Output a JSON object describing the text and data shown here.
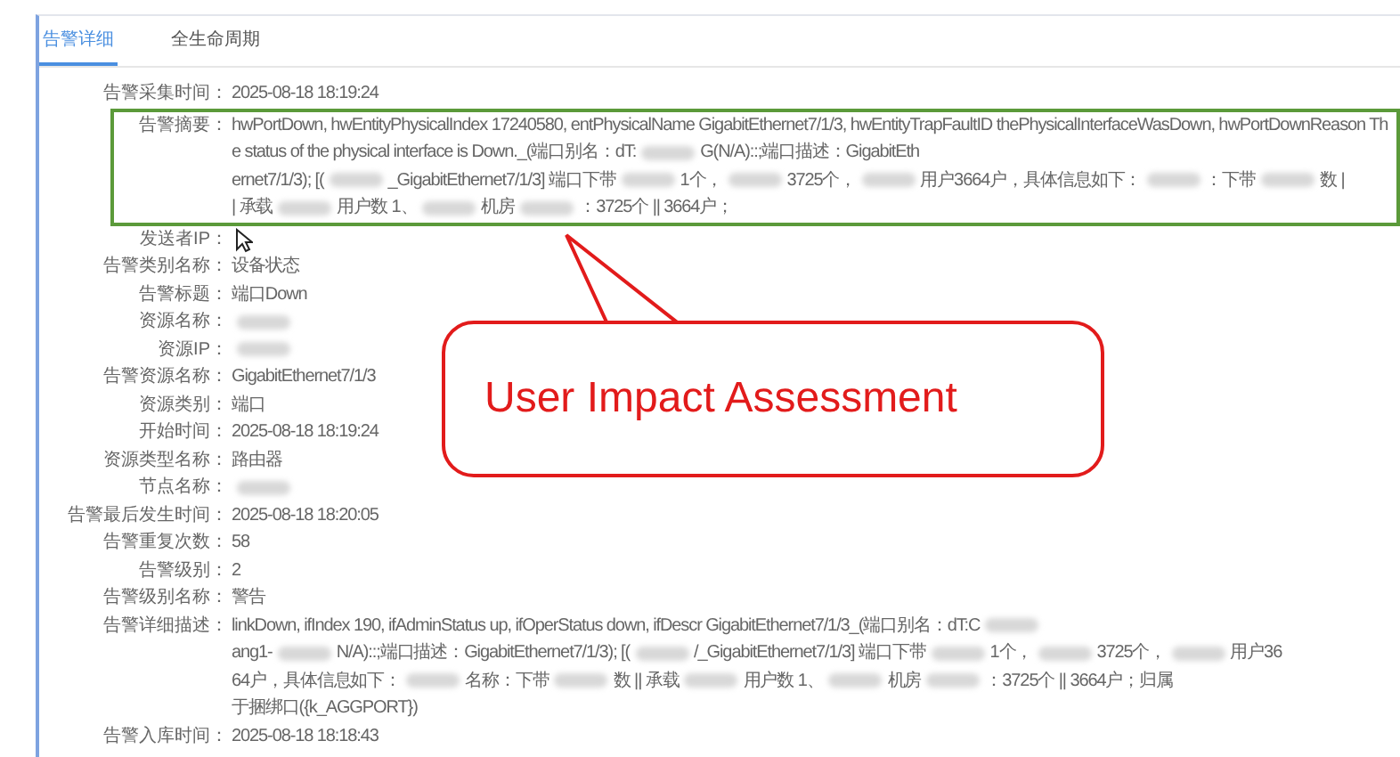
{
  "tabs": [
    {
      "label": "告警详细",
      "selected": true
    },
    {
      "label": "全生命周期",
      "selected": false
    }
  ],
  "fields": [
    {
      "label": "告警采集时间：",
      "highlighted": false,
      "lines": [
        [
          {
            "kind": "text",
            "text": "2025-08-18 18:19:24"
          }
        ]
      ]
    },
    {
      "label": "告警摘要：",
      "highlighted": true,
      "lines": [
        [
          {
            "kind": "text",
            "text": "hwPortDown, hwEntityPhysicalIndex 17240580, entPhysicalName GigabitEthernet7/1/3, hwEntityTrapFaultID thePhysicalInterfaceWasDown, hwPortDownReason Th"
          }
        ],
        [
          {
            "kind": "text",
            "text": "e status of the physical interface is Down._(端口别名：dT:"
          },
          {
            "kind": "redacted"
          },
          {
            "kind": "text",
            "text": "G(N/A)::;端口描述：GigabitEth"
          }
        ],
        [
          {
            "kind": "text",
            "text": "ernet7/1/3); [("
          },
          {
            "kind": "redacted"
          },
          {
            "kind": "text",
            "text": "_GigabitEthernet7/1/3] 端口下带"
          },
          {
            "kind": "redacted"
          },
          {
            "kind": "text",
            "text": "1个，"
          },
          {
            "kind": "redacted"
          },
          {
            "kind": "text",
            "text": "3725个，"
          },
          {
            "kind": "redacted"
          },
          {
            "kind": "text",
            "text": "用户3664户，具体信息如下："
          },
          {
            "kind": "redacted"
          },
          {
            "kind": "text",
            "text": "：下带"
          },
          {
            "kind": "redacted"
          },
          {
            "kind": "text",
            "text": "数 |"
          }
        ],
        [
          {
            "kind": "text",
            "text": "| 承载"
          },
          {
            "kind": "redacted"
          },
          {
            "kind": "text",
            "text": "用户数 1、"
          },
          {
            "kind": "redacted"
          },
          {
            "kind": "text",
            "text": "机房"
          },
          {
            "kind": "redacted"
          },
          {
            "kind": "text",
            "text": "：3725个 || 3664户；"
          }
        ]
      ]
    },
    {
      "label": "发送者IP：",
      "highlighted": false
    },
    {
      "label": "告警类别名称：",
      "highlighted": false,
      "lines": [
        [
          {
            "kind": "text",
            "text": "设备状态"
          }
        ]
      ]
    },
    {
      "label": "告警标题：",
      "highlighted": false,
      "lines": [
        [
          {
            "kind": "text",
            "text": "端口Down"
          }
        ]
      ]
    },
    {
      "label": "资源名称：",
      "highlighted": false,
      "lines": [
        [
          {
            "kind": "redacted"
          }
        ]
      ]
    },
    {
      "label": "资源IP：",
      "highlighted": false,
      "lines": [
        [
          {
            "kind": "redacted"
          }
        ]
      ]
    },
    {
      "label": "告警资源名称：",
      "highlighted": false,
      "lines": [
        [
          {
            "kind": "text",
            "text": "GigabitEthernet7/1/3"
          }
        ]
      ]
    },
    {
      "label": "资源类别：",
      "highlighted": false,
      "lines": [
        [
          {
            "kind": "text",
            "text": "端口"
          }
        ]
      ]
    },
    {
      "label": "开始时间：",
      "highlighted": false,
      "lines": [
        [
          {
            "kind": "text",
            "text": "2025-08-18 18:19:24"
          }
        ]
      ]
    },
    {
      "label": "资源类型名称：",
      "highlighted": false,
      "lines": [
        [
          {
            "kind": "text",
            "text": "路由器"
          }
        ]
      ]
    },
    {
      "label": "节点名称：",
      "highlighted": false,
      "lines": [
        [
          {
            "kind": "redacted"
          }
        ]
      ]
    },
    {
      "label": "告警最后发生时间：",
      "highlighted": false,
      "lines": [
        [
          {
            "kind": "text",
            "text": "2025-08-18 18:20:05"
          }
        ]
      ]
    },
    {
      "label": "告警重复次数：",
      "highlighted": false,
      "lines": [
        [
          {
            "kind": "text",
            "text": "58"
          }
        ]
      ]
    },
    {
      "label": "告警级别：",
      "highlighted": false,
      "lines": [
        [
          {
            "kind": "text",
            "text": "2"
          }
        ]
      ]
    },
    {
      "label": "告警级别名称：",
      "highlighted": false,
      "lines": [
        [
          {
            "kind": "text",
            "text": "警告"
          }
        ]
      ]
    },
    {
      "label": "告警详细描述：",
      "highlighted": false,
      "lines": [
        [
          {
            "kind": "text",
            "text": "linkDown, ifIndex 190, ifAdminStatus up, ifOperStatus down, ifDescr GigabitEthernet7/1/3_(端口别名：dT:C"
          },
          {
            "kind": "redacted"
          }
        ],
        [
          {
            "kind": "text",
            "text": "ang1-"
          },
          {
            "kind": "redacted"
          },
          {
            "kind": "text",
            "text": "N/A)::;端口描述：GigabitEthernet7/1/3); [("
          },
          {
            "kind": "redacted"
          },
          {
            "kind": "text",
            "text": "/_GigabitEthernet7/1/3] 端口下带"
          },
          {
            "kind": "redacted"
          },
          {
            "kind": "text",
            "text": "1个，"
          },
          {
            "kind": "redacted"
          },
          {
            "kind": "text",
            "text": "3725个，"
          },
          {
            "kind": "redacted"
          },
          {
            "kind": "text",
            "text": "用户36"
          }
        ],
        [
          {
            "kind": "text",
            "text": "64户，具体信息如下："
          },
          {
            "kind": "redacted"
          },
          {
            "kind": "text",
            "text": "名称：下带"
          },
          {
            "kind": "redacted"
          },
          {
            "kind": "text",
            "text": "数 || 承载"
          },
          {
            "kind": "redacted"
          },
          {
            "kind": "text",
            "text": "用户数 1、"
          },
          {
            "kind": "redacted"
          },
          {
            "kind": "text",
            "text": "机房"
          },
          {
            "kind": "redacted"
          },
          {
            "kind": "text",
            "text": "：3725个 || 3664户；归属"
          }
        ],
        [
          {
            "kind": "text",
            "text": "于捆绑口({k_AGGPORT})"
          }
        ]
      ]
    },
    {
      "label": "告警入库时间：",
      "highlighted": false,
      "lines": [
        [
          {
            "kind": "text",
            "text": "2025-08-18 18:18:43"
          }
        ]
      ]
    }
  ],
  "callout": {
    "text": "User Impact Assessment"
  }
}
